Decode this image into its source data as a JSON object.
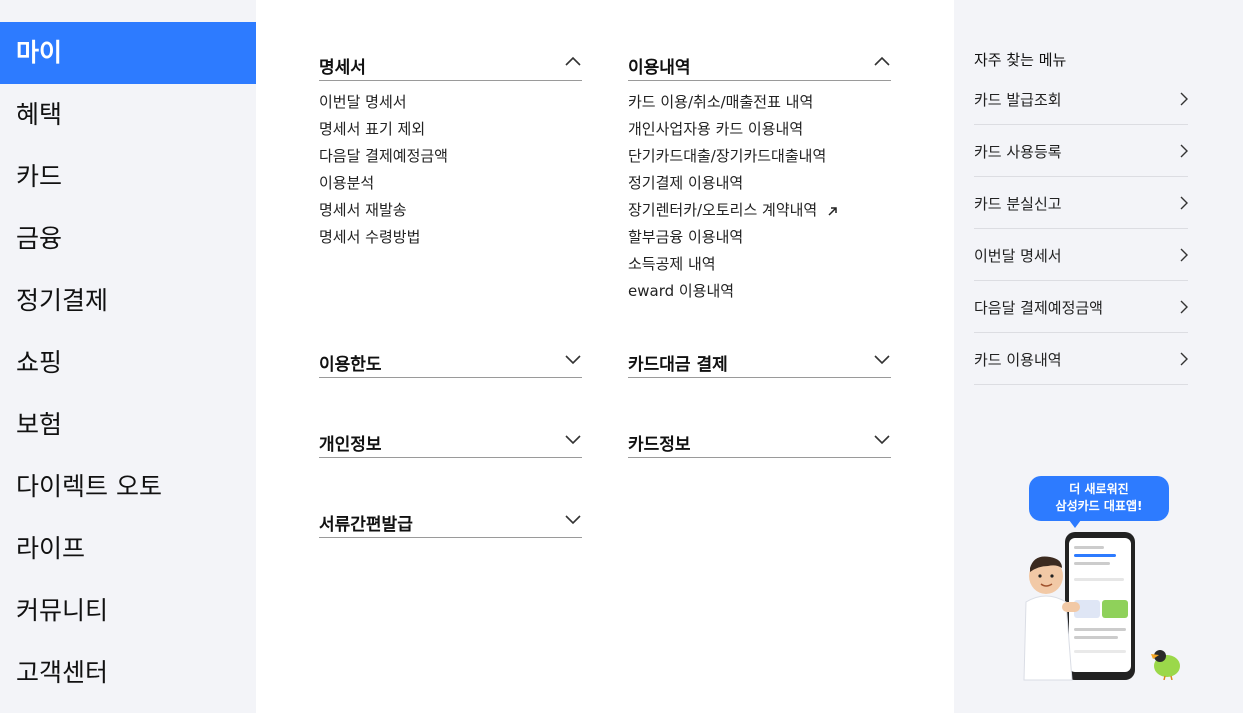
{
  "left_nav": {
    "items": [
      {
        "label": "마이",
        "active": true
      },
      {
        "label": "혜택"
      },
      {
        "label": "카드"
      },
      {
        "label": "금융"
      },
      {
        "label": "정기결제"
      },
      {
        "label": "쇼핑"
      },
      {
        "label": "보험"
      },
      {
        "label": "다이렉트 오토"
      },
      {
        "label": "라이프"
      },
      {
        "label": "커뮤니티"
      },
      {
        "label": "고객센터"
      }
    ]
  },
  "main": {
    "sections": [
      {
        "title": "명세서",
        "expanded": true,
        "links": [
          "이번달 명세서",
          "명세서 표기 제외",
          "다음달 결제예정금액",
          "이용분석",
          "명세서 재발송",
          "명세서 수령방법"
        ]
      },
      {
        "title": "이용내역",
        "expanded": true,
        "links": [
          "카드 이용/취소/매출전표 내역",
          "개인사업자용 카드 이용내역",
          "단기카드대출/장기카드대출내역",
          "정기결제 이용내역",
          "장기렌터카/오토리스 계약내역",
          "할부금융 이용내역",
          "소득공제 내역",
          "eward 이용내역"
        ]
      },
      {
        "title": "이용한도",
        "expanded": false
      },
      {
        "title": "카드대금 결제",
        "expanded": false
      },
      {
        "title": "개인정보",
        "expanded": false
      },
      {
        "title": "카드정보",
        "expanded": false
      },
      {
        "title": "서류간편발급",
        "expanded": false
      }
    ]
  },
  "right_panel": {
    "title": "자주 찾는 메뉴",
    "items": [
      "카드 발급조회",
      "카드 사용등록",
      "카드 분실신고",
      "이번달 명세서",
      "다음달 결제예정금액",
      "카드 이용내역"
    ]
  },
  "promo": {
    "line1": "더 새로워진",
    "line2": "삼성카드 대표앱!"
  },
  "colors": {
    "accent": "#2d7bff",
    "panel_bg": "#f3f4f8"
  }
}
